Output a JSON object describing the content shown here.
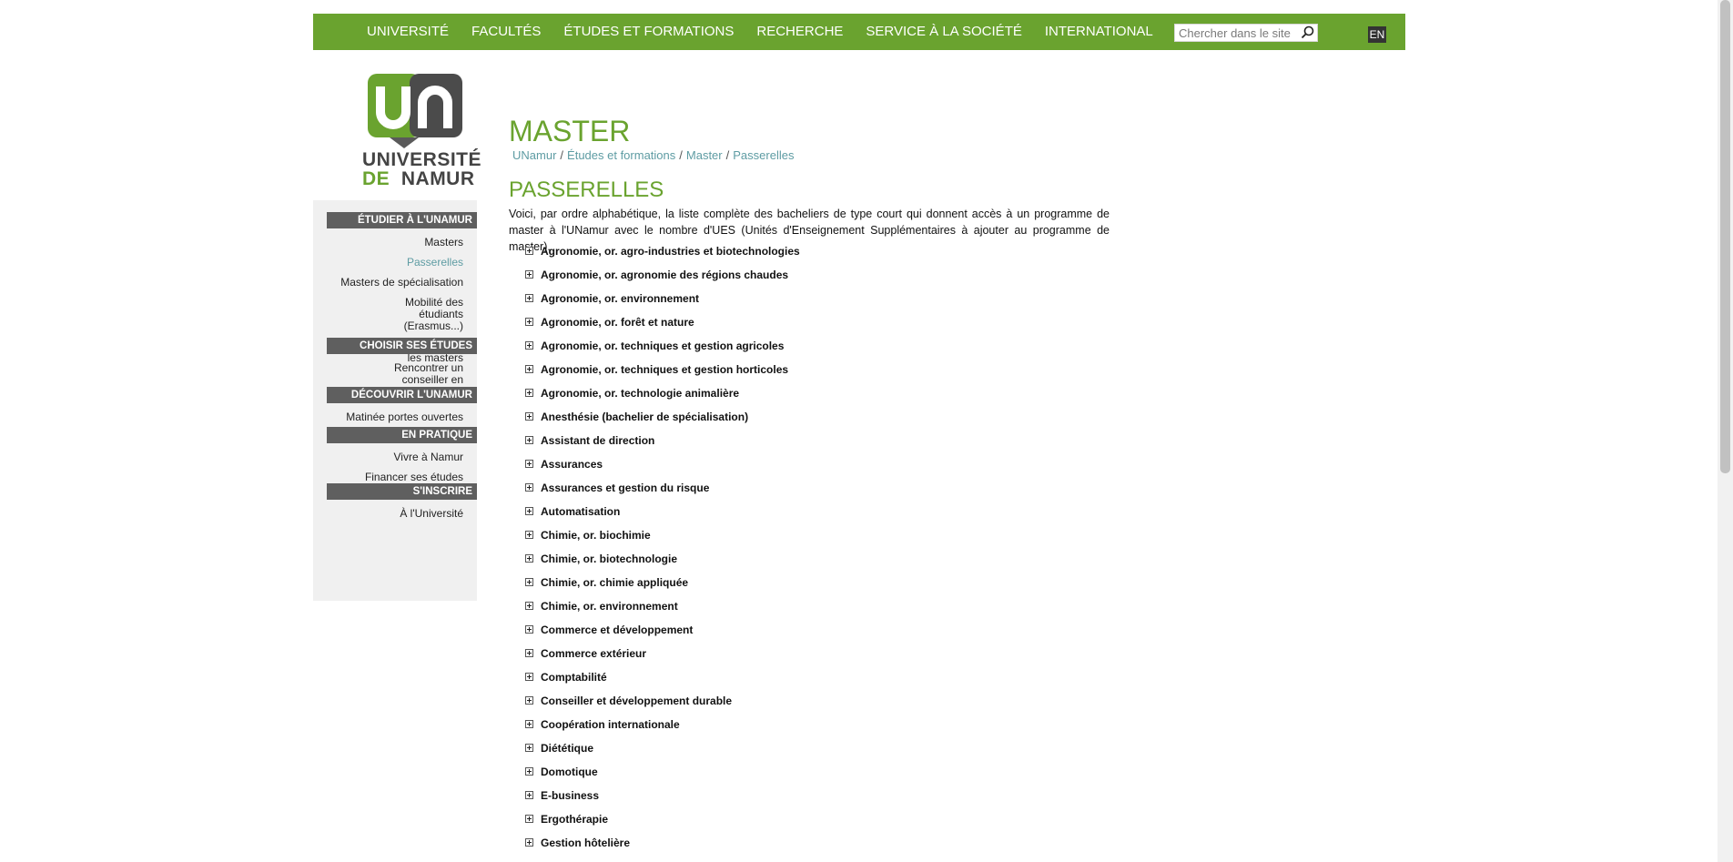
{
  "nav": {
    "items": [
      "UNIVERSITÉ",
      "FACULTÉS",
      "ÉTUDES ET FORMATIONS",
      "RECHERCHE",
      "SERVICE À LA SOCIÉTÉ",
      "INTERNATIONAL"
    ],
    "search_placeholder": "Chercher dans le site",
    "lang": "EN"
  },
  "logo": {
    "line1": "UNIVERSITÉ",
    "line2_a": "DE",
    "line2_b": "NAMUR"
  },
  "sidebar": {
    "sections": [
      {
        "title": "ÉTUDIER À L'UNAMUR",
        "links": [
          "Masters",
          "Passerelles",
          "Masters de spécialisation",
          "Mobilité des étudiants (Erasmus...)",
          "Documentation sur les masters"
        ]
      },
      {
        "title": "CHOISIR SES ÉTUDES",
        "links": [
          "Rencontrer un conseiller en orientation"
        ]
      },
      {
        "title": "DÉCOUVRIR L'UNAMUR",
        "links": [
          "Matinée portes ouvertes"
        ]
      },
      {
        "title": "EN PRATIQUE",
        "links": [
          "Vivre à Namur",
          "Financer ses études"
        ]
      },
      {
        "title": "S'INSCRIRE",
        "links": [
          "À l'Université"
        ]
      }
    ]
  },
  "main": {
    "title": "MASTER",
    "breadcrumb": [
      "UNamur",
      "Études et formations",
      "Master",
      "Passerelles"
    ],
    "section_title": "PASSERELLES",
    "intro": "Voici, par ordre alphabétique, la liste complète des bacheliers de type court qui donnent accès à un programme de master à l'UNamur avec le nombre d'UES (Unités d'Enseignement Supplémentaires à ajouter au programme de master).",
    "items": [
      "Agronomie, or. agro-industries et biotechnologies",
      "Agronomie, or. agronomie des régions chaudes",
      "Agronomie, or. environnement",
      "Agronomie, or. forêt et nature",
      "Agronomie, or. techniques et gestion agricoles",
      "Agronomie, or. techniques et gestion horticoles",
      "Agronomie, or. technologie animalière",
      "Anesthésie (bachelier de spécialisation)",
      "Assistant de direction",
      "Assurances",
      "Assurances et gestion du risque",
      "Automatisation",
      "Chimie, or. biochimie",
      "Chimie, or.  biotechnologie",
      "Chimie, or. chimie appliquée",
      "Chimie, or. environnement",
      "Commerce et développement",
      "Commerce extérieur",
      "Comptabilité",
      "Conseiller et développement durable",
      "Coopération internationale",
      "Diététique",
      "Domotique",
      "E-business",
      "Ergothérapie",
      "Gestion hôtelière"
    ]
  },
  "colors": {
    "brand_green": "#6aa32f",
    "link_teal": "#5e9ca3",
    "sidebar_head": "#5f5f5f"
  }
}
